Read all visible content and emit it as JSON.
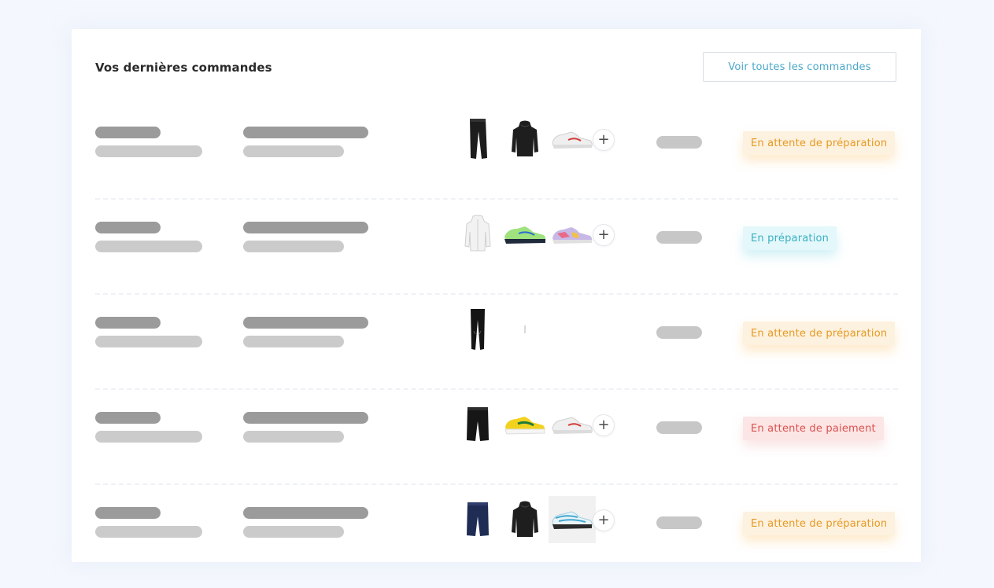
{
  "card": {
    "title": "Vos dernières commandes",
    "view_all_label": "Voir toutes les commandes"
  },
  "orders": [
    {
      "items": [
        "black-track-pants-icon",
        "black-hoodie-icon",
        "white-sneaker-icon"
      ],
      "has_more": true,
      "more_label": "+",
      "status": "En attente de préparation",
      "status_color": "orange"
    },
    {
      "items": [
        "white-jacket-icon",
        "green-running-shoe-icon",
        "multicolor-sneaker-icon"
      ],
      "has_more": true,
      "more_label": "+",
      "status": "En préparation",
      "status_color": "cyan"
    },
    {
      "items": [
        "black-tights-icon",
        "small-sock-icon"
      ],
      "has_more": false,
      "more_label": "",
      "status": "En attente de préparation",
      "status_color": "orange"
    },
    {
      "items": [
        "black-shorts-icon",
        "yellow-green-sneaker-icon",
        "white-sneaker-icon"
      ],
      "has_more": true,
      "more_label": "+",
      "status": "En attente de paiement",
      "status_color": "red"
    },
    {
      "items": [
        "navy-shorts-icon",
        "black-hoodie-icon",
        "blue-air-max-icon"
      ],
      "has_more": true,
      "more_label": "+",
      "status": "En attente de préparation",
      "status_color": "orange"
    }
  ],
  "colors": {
    "accent": "#4aa8c9",
    "orange": "#e69a22",
    "cyan": "#3ab0c3",
    "red": "#d9534f"
  }
}
